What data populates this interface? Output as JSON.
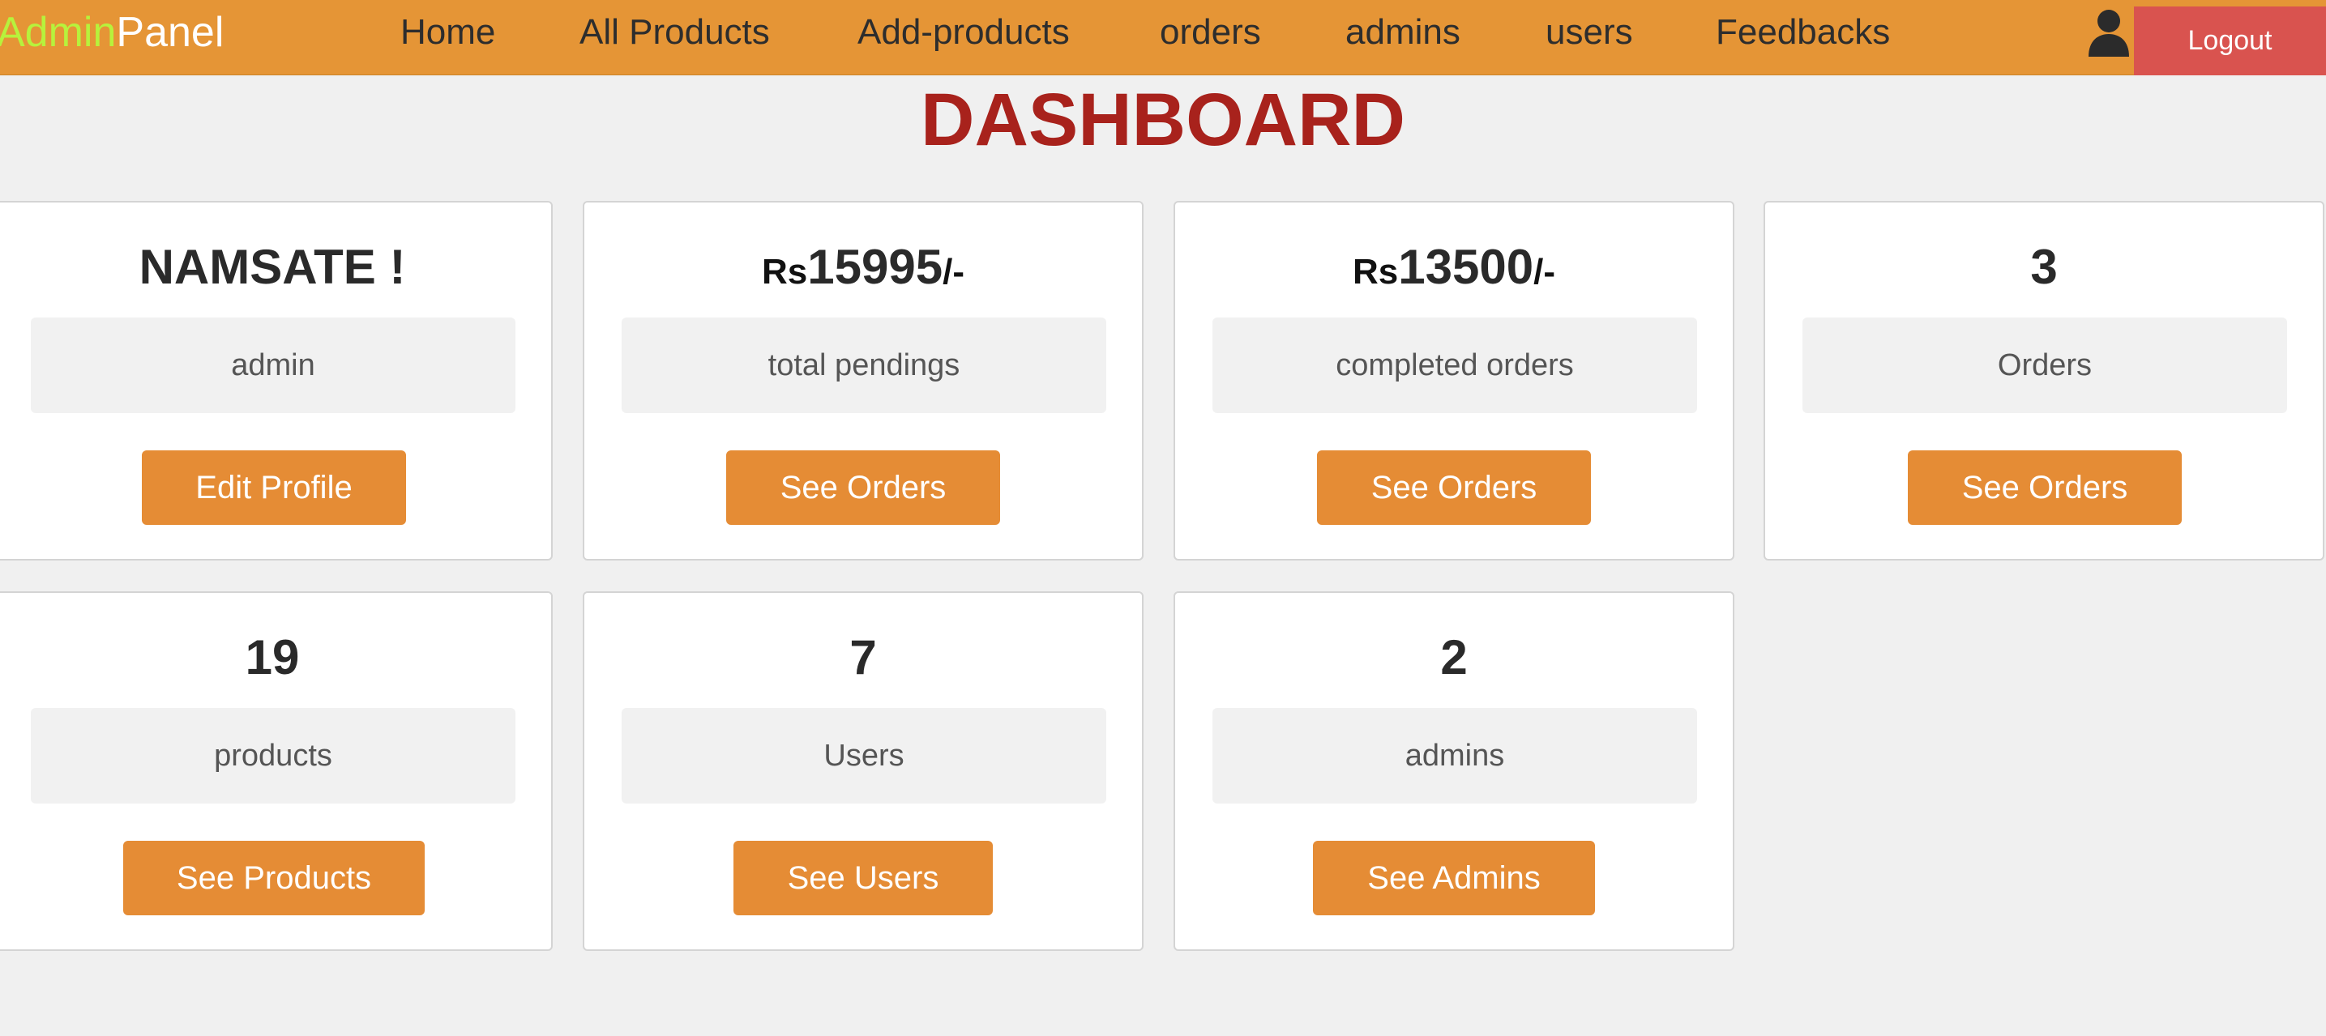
{
  "header": {
    "logo_part1": "Admin",
    "logo_part2": "Panel",
    "nav": [
      "Home",
      "All Products",
      "Add-products",
      "orders",
      "admins",
      "users",
      "Feedbacks"
    ],
    "user_icon": "user-icon",
    "logout": "Logout"
  },
  "page": {
    "title": "DASHBOARD"
  },
  "cards": [
    {
      "value": "NAMSATE !",
      "label": "admin",
      "button": "Edit Profile"
    },
    {
      "currency": "Rs",
      "value": "15995",
      "suffix": "/-",
      "label": "total pendings",
      "button": "See Orders"
    },
    {
      "currency": "Rs",
      "value": "13500",
      "suffix": "/-",
      "label": "completed orders",
      "button": "See Orders"
    },
    {
      "value": "3",
      "label": "Orders",
      "button": "See Orders"
    },
    {
      "value": "19",
      "label": "products",
      "button": "See Products"
    },
    {
      "value": "7",
      "label": "Users",
      "button": "See Users"
    },
    {
      "value": "2",
      "label": "admins",
      "button": "See Admins"
    }
  ],
  "colors": {
    "header_bg": "#e59536",
    "logo_accent": "#b7f23c",
    "title": "#a8221c",
    "button": "#e58c35",
    "logout": "#d9534f"
  }
}
